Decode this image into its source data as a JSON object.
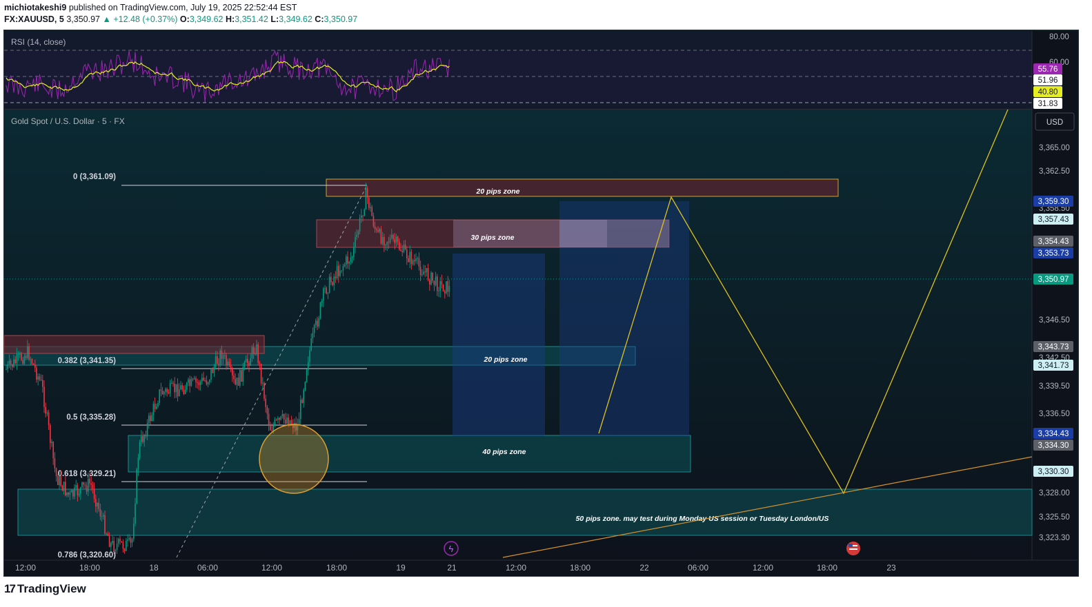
{
  "header": {
    "author": "michiotakeshi9",
    "published_text": "published on TradingView.com, July 19, 2025 22:52:44 EST",
    "symbol": "FX:XAUUSD, 5",
    "last": "3,350.97",
    "change": "▲ +12.48 (+0.37%)",
    "o_label": "O:",
    "o": "3,349.62",
    "h_label": "H:",
    "h": "3,351.42",
    "l_label": "L:",
    "l": "3,349.62",
    "c_label": "C:",
    "c": "3,350.97"
  },
  "rsi": {
    "title": "RSI (14, close)",
    "levels": [
      "80.00",
      "60.00"
    ],
    "badges": [
      {
        "text": "55.76",
        "bg": "#9c27b0",
        "fg": "#ffffff"
      },
      {
        "text": "51.96",
        "bg": "#ffffff",
        "fg": "#131722"
      },
      {
        "text": "40.80",
        "bg": "#e6ee20",
        "fg": "#131722"
      },
      {
        "text": "31.83",
        "bg": "#ffffff",
        "fg": "#131722"
      }
    ]
  },
  "main": {
    "title": "Gold Spot / U.S. Dollar · 5 · FX",
    "currency": "USD",
    "price_axis": [
      "3,365.00",
      "3,362.50",
      "3,358.50",
      "3,346.50",
      "3,342.50",
      "3,339.50",
      "3,336.50",
      "3,328.00",
      "3,325.50",
      "3,323.30"
    ],
    "price_badges": [
      {
        "text": "3,359.30",
        "bg": "#1b3ea6",
        "fg": "#ffffff"
      },
      {
        "text": "3,357.43",
        "bg": "#cdeef3",
        "fg": "#131722"
      },
      {
        "text": "3,354.43",
        "bg": "#5d6069",
        "fg": "#ffffff"
      },
      {
        "text": "3,353.73",
        "bg": "#1b3ea6",
        "fg": "#ffffff"
      },
      {
        "text": "3,350.97",
        "bg": "#089981",
        "fg": "#ffffff"
      },
      {
        "text": "3,343.73",
        "bg": "#5d6069",
        "fg": "#ffffff"
      },
      {
        "text": "3,341.73",
        "bg": "#cdeef3",
        "fg": "#131722"
      },
      {
        "text": "3,334.43",
        "bg": "#1b3ea6",
        "fg": "#ffffff"
      },
      {
        "text": "3,334.30",
        "bg": "#5d6069",
        "fg": "#ffffff"
      },
      {
        "text": "3,330.30",
        "bg": "#cdeef3",
        "fg": "#131722"
      }
    ],
    "time_axis": [
      "12:00",
      "18:00",
      "18",
      "06:00",
      "12:00",
      "18:00",
      "19",
      "21",
      "12:00",
      "18:00",
      "22",
      "06:00",
      "12:00",
      "18:00",
      "23"
    ],
    "fib_levels": [
      {
        "label": "0 (3,361.09)"
      },
      {
        "label": "0.382 (3,341.35)"
      },
      {
        "label": "0.5 (3,335.28)"
      },
      {
        "label": "0.618 (3,329.21)"
      },
      {
        "label": "0.786 (3,320.60)"
      }
    ],
    "zones": {
      "z1": "20 pips zone",
      "z2": "30 pips zone",
      "z3": "20 pips zone",
      "z4": "40 pips zone",
      "z5": "50 pips zone. may test during Monday US session or Tuesday London/US"
    }
  },
  "footer": {
    "logo_mark": "17",
    "logo_text": "TradingView"
  },
  "colors": {
    "up": "#089981",
    "down": "#f23645",
    "rsi_line": "#9c27b0",
    "rsi_ma": "#e6ee20",
    "projection": "#e0c020",
    "trendline": "#d79327"
  }
}
